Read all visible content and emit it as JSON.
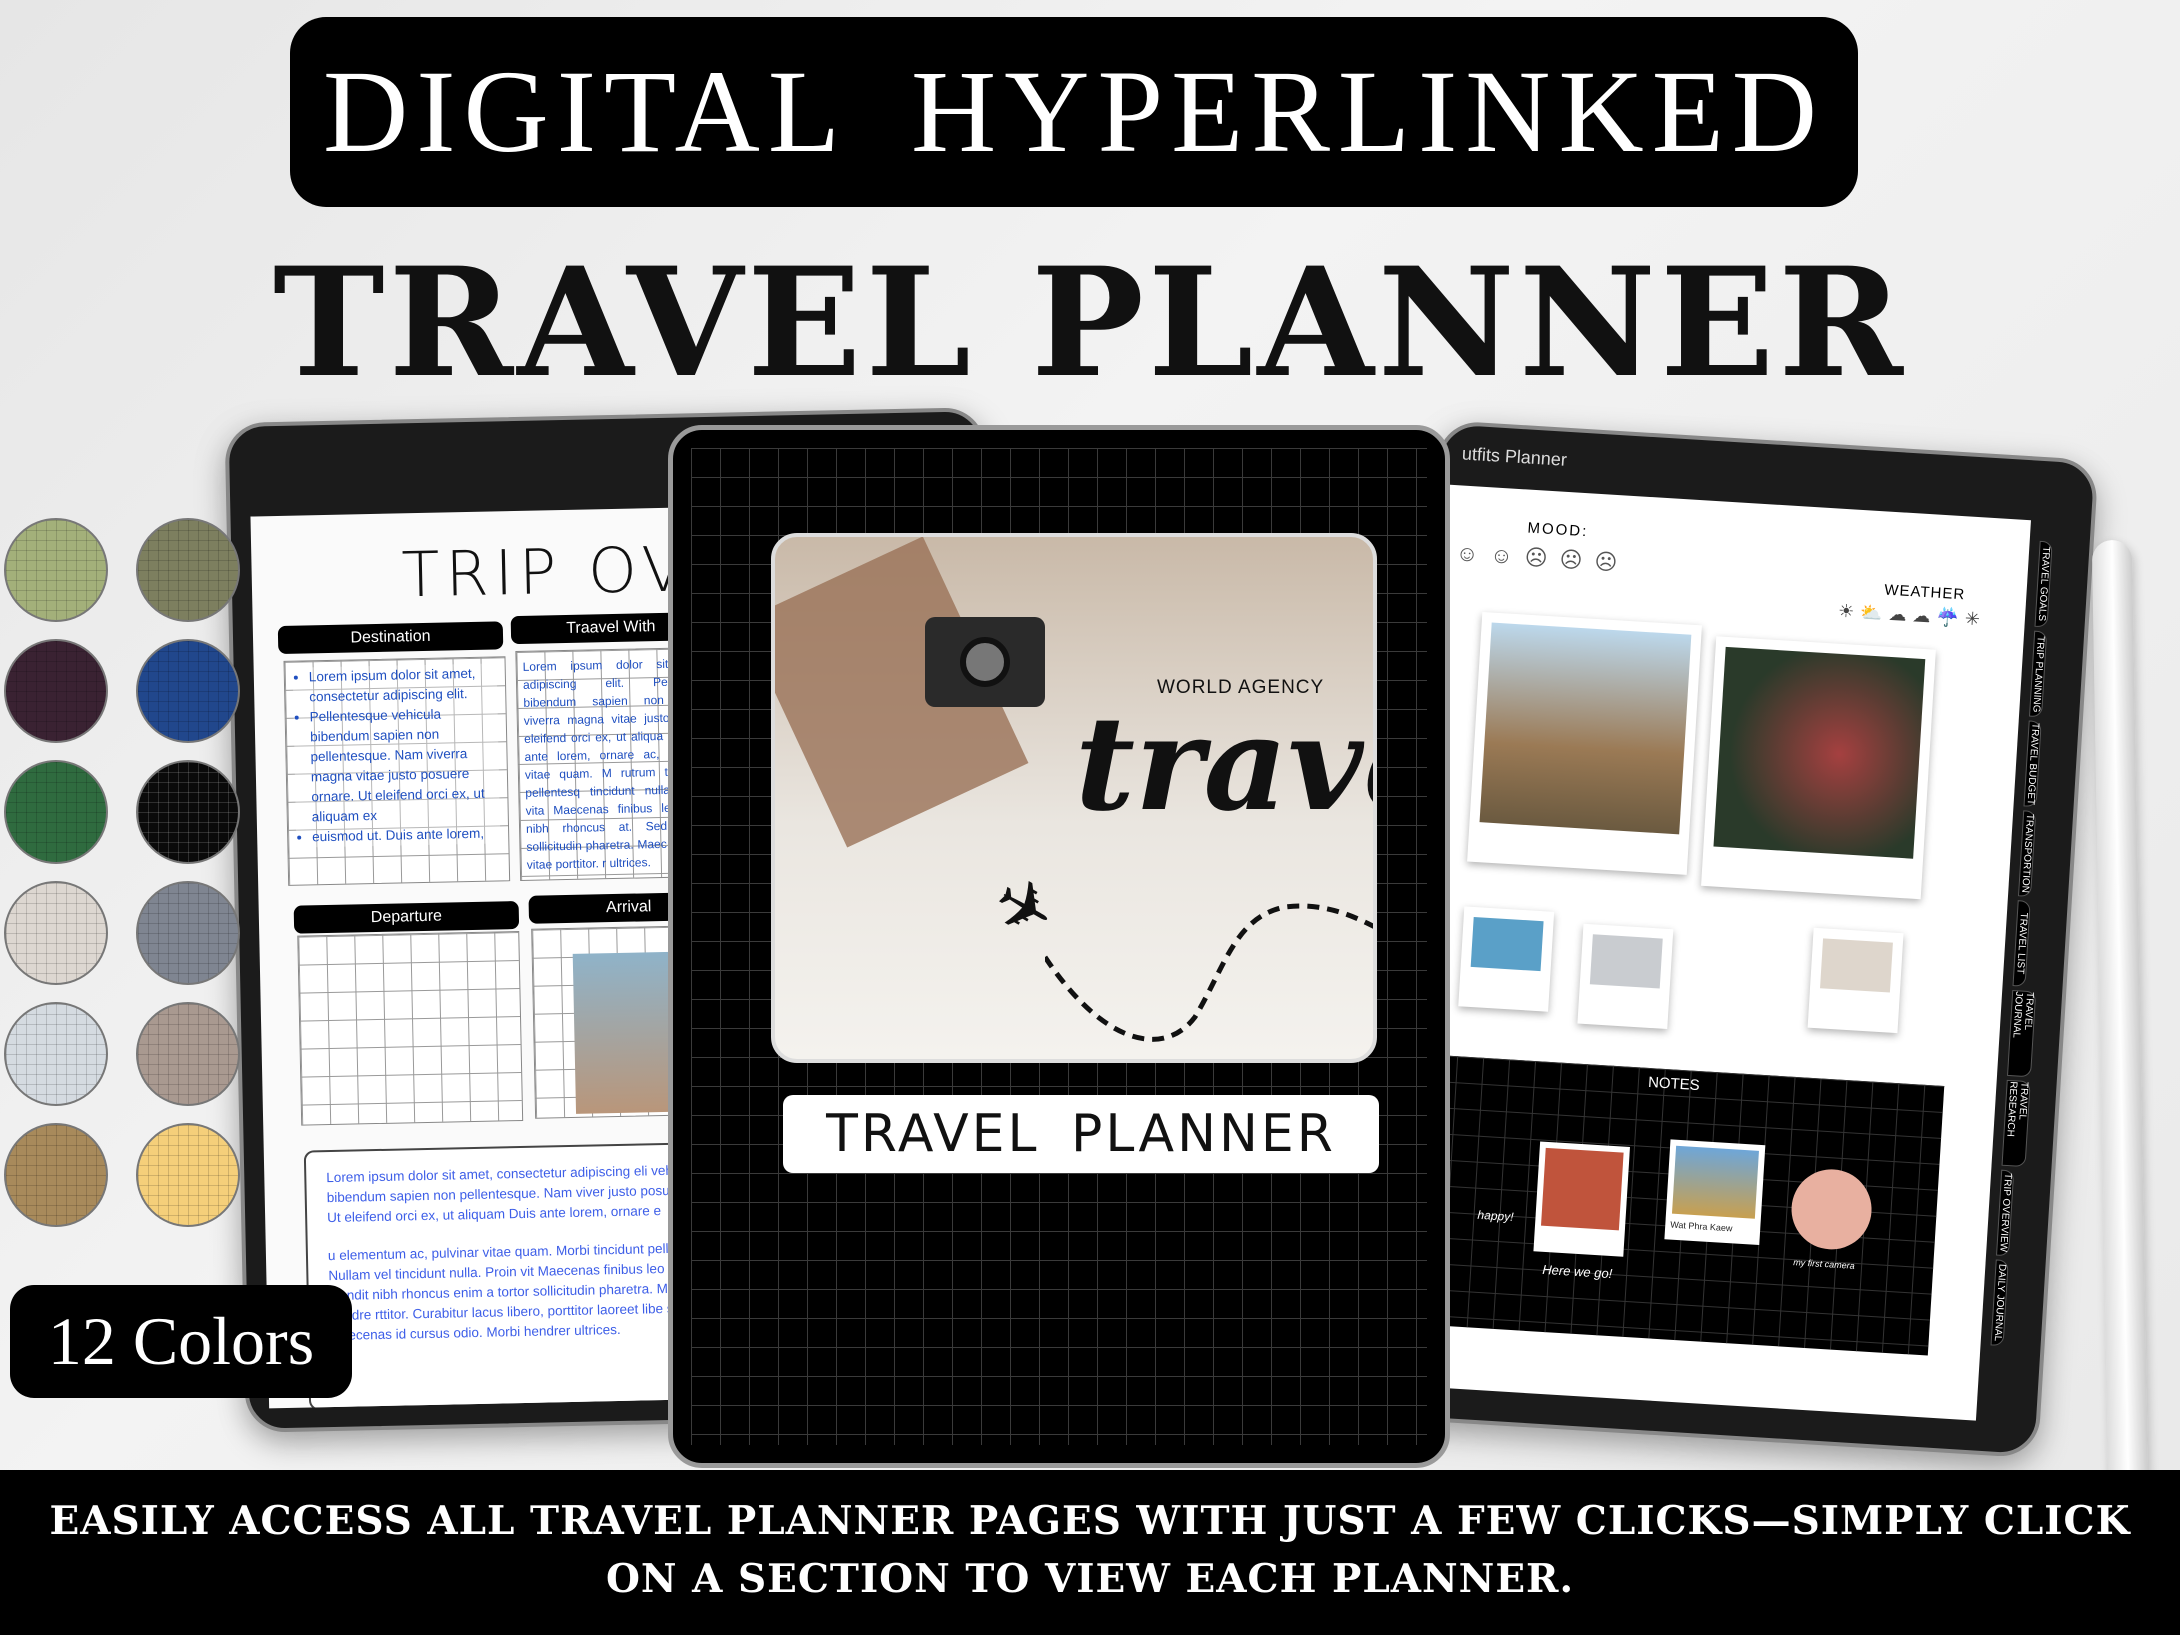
{
  "header": {
    "line1": "DIGITAL HYPERLINKED",
    "line2": "TRAVEL PLANNER"
  },
  "left_page": {
    "title": "TRIP OVER",
    "sections": {
      "destination": "Destination",
      "travel_with": "Traavel With",
      "departure": "Departure",
      "arrival": "Arrival"
    },
    "destination_bullets": [
      "Lorem ipsum dolor sit amet, consectetur adipiscing elit.",
      "Pellentesque vehicula bibendum sapien non pellentesque. Nam viverra magna vitae justo posuere ornare. Ut eleifend orci ex, ut aliquam ex",
      "euismod ut. Duis ante lorem,"
    ],
    "travel_with_text": "Lorem ipsum dolor sit amet adipiscing elit. Pellentesq bibendum sapien non peller viverra magna vitae justo po Ut eleifend orci ex, ut aliqua ut. Duis ante lorem, ornare ac, pulvinar vitae quam. M rutrum tortor in pellentesq tincidunt nulla. Proin vita Maecenas finibus leo lectu nibh rhoncus at. Sed pulvin sollicitudin pharetra. Maec a lectus vitae porttitor. r ultrices.",
    "notes_p1": "Lorem ipsum dolor sit amet, consectetur adipiscing eli vehicula bibendum sapien non pellentesque. Nam viver justo posuere ornare. Ut eleifend orci ex, ut aliquam Duis ante lorem, ornare e",
    "notes_p2": "u elementum ac, pulvinar vitae quam. Morbi tincidunt pellentesque. Nullam vel tincidunt nulla. Proin vit Maecenas finibus leo lectus, non blandit nibh rhoncus enim a tortor sollicitudin pharetra. Maecenas hendre rttitor. Curabitur lacus libero, porttitor laoreet libe stique mi. Maecenas id cursus odio. Morbi hendrer ultrices."
  },
  "cover": {
    "agency": "WORLD AGENCY",
    "script": "travel",
    "title": "TRAVEL PLANNER"
  },
  "right_page": {
    "title": "utfits Planner",
    "mood_label": "MOOD:",
    "weather_label": "WEATHER",
    "notes_label": "NOTES",
    "mood_icons": [
      "☺",
      "☺",
      "☹",
      "☹",
      "☹"
    ],
    "weather_icons": [
      "☀",
      "⛅",
      "☁",
      "☁",
      "☔",
      "✳"
    ],
    "tabs": [
      "TRAVEL GOALS",
      "TRIP PLANNING",
      "TRAVEL BUDGET",
      "TRANSPORTION",
      "TRAVEL LIST",
      "TRAVEL JOURNAL",
      "TRAVEL RESEARCH",
      "TRIP OVERVIEW",
      "DAILY JOURNAL"
    ],
    "sticker_texts": [
      "happy!",
      "Here we go!",
      "Wat Phra Kaew",
      "my first camera"
    ]
  },
  "colors": {
    "label": "12 Colors",
    "swatches": [
      "#a3b07a",
      "#7d7f5f",
      "#3a2232",
      "#21478c",
      "#2f6b3f",
      "#0a0a0a",
      "#ddd7d1",
      "#7f8591",
      "#d5dbe1",
      "#a99990",
      "#a88a5b",
      "#f5cf7a"
    ]
  },
  "footer": {
    "line1": "EASILY ACCESS ALL TRAVEL PLANNER PAGES WITH JUST A FEW CLICKS—SIMPLY CLICK",
    "line2": "ON A SECTION TO VIEW EACH PLANNER."
  }
}
